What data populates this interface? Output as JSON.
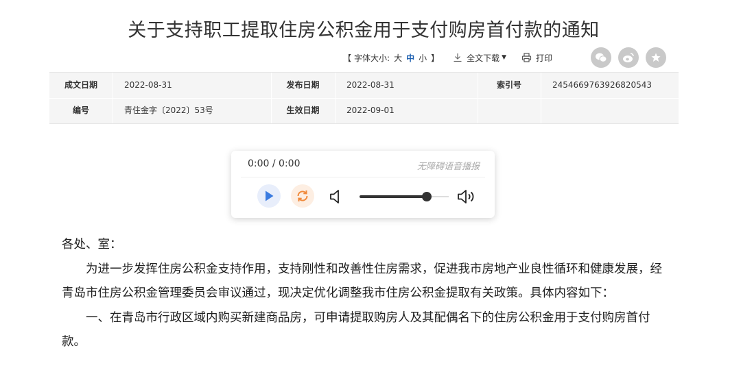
{
  "title": "关于支持职工提取住房公积金用于支付购房首付款的通知",
  "toolbar": {
    "bracket_open": "【",
    "font_size_label": "字体大小:",
    "size_large": "大",
    "size_medium": "中",
    "size_small": "小",
    "bracket_close": "】",
    "download_label": "全文下载",
    "print_label": "打印"
  },
  "share_icons": [
    "wechat-icon",
    "weibo-icon",
    "star-icon"
  ],
  "meta": {
    "row1": {
      "label1": "成文日期",
      "value1": "2022-08-31",
      "label2": "发布日期",
      "value2": "2022-08-31",
      "label3": "索引号",
      "value3": "2454669763926820543"
    },
    "row2": {
      "label1": "编号",
      "value1": "青住金字〔2022〕53号",
      "label2": "生效日期",
      "value2": "2022-09-01"
    }
  },
  "player": {
    "time": "0:00 / 0:00",
    "tts_label": "无障碍语音播报",
    "volume_level": 0.75,
    "accent_play": "#3a7be0",
    "accent_loop": "#f08a3c"
  },
  "content": {
    "greeting": "各处、室：",
    "para1": "为进一步发挥住房公积金支持作用，支持刚性和改善性住房需求，促进我市房地产业良性循环和健康发展，经青岛市住房公积金管理委员会审议通过，现决定优化调整我市住房公积金提取有关政策。具体内容如下：",
    "para2": "一、在青岛市行政区域内购买新建商品房，可申请提取购房人及其配偶名下的住房公积金用于支付购房首付款。"
  }
}
